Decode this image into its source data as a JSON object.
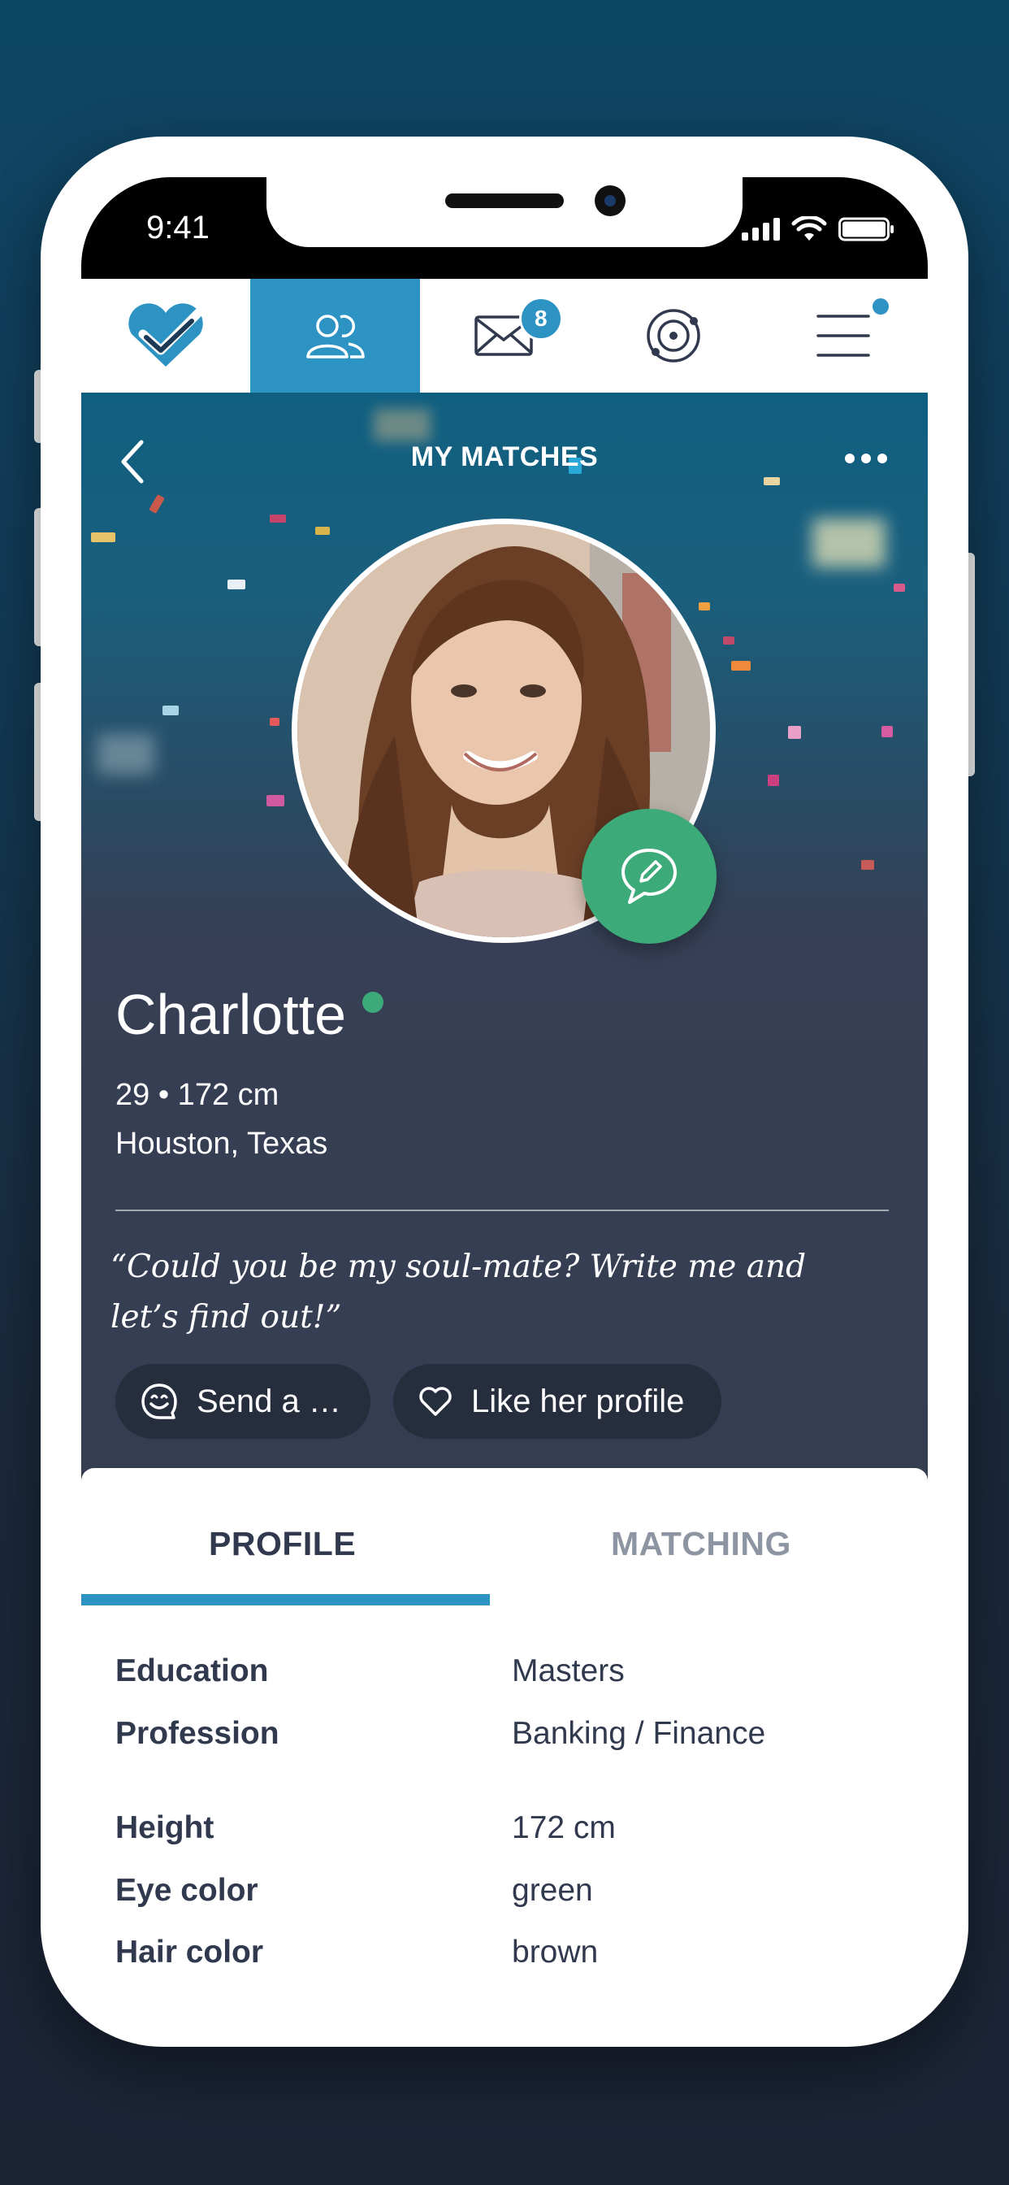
{
  "status_bar": {
    "time": "9:41"
  },
  "nav": {
    "messages_badge": "8"
  },
  "header": {
    "title": "MY MATCHES"
  },
  "profile": {
    "name": "Charlotte",
    "age_height": "29 • 172 cm",
    "location": "Houston, Texas",
    "quote": "“Could you be my soul-mate? Write me and let’s find out!”",
    "send_label": "Send a …",
    "like_label": "Like her profile"
  },
  "tabs": [
    {
      "label": "PROFILE",
      "active": true
    },
    {
      "label": "MATCHING",
      "active": false
    }
  ],
  "details": [
    {
      "label": "Education",
      "value": "Masters"
    },
    {
      "label": "Profession",
      "value": "Banking / Finance"
    },
    {
      "label": "Height",
      "value": "172 cm"
    },
    {
      "label": "Eye color",
      "value": "green"
    },
    {
      "label": "Hair color",
      "value": "brown"
    }
  ],
  "colors": {
    "accent": "#2c93c3",
    "online": "#3daa79",
    "dark_panel": "#353d51",
    "pill": "#262d3d"
  }
}
